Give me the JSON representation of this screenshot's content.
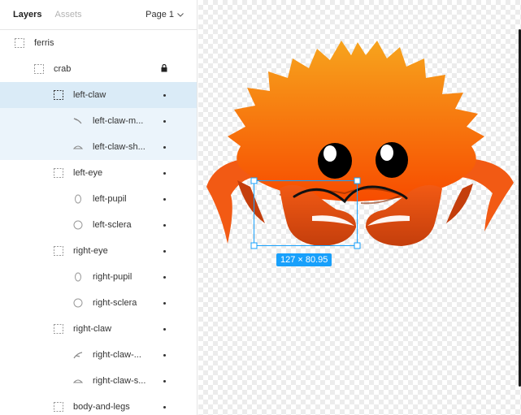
{
  "tabs": {
    "layers": "Layers",
    "assets": "Assets"
  },
  "page_select": {
    "label": "Page 1"
  },
  "layers": [
    {
      "label": "ferris",
      "icon": "frame-icon",
      "state": "normal"
    },
    {
      "label": "crab",
      "icon": "frame-icon",
      "state": "locked"
    },
    {
      "label": "left-claw",
      "icon": "frame-icon",
      "state": "selected"
    },
    {
      "label": "left-claw-m...",
      "icon": "vector-icon",
      "state": "child-selected"
    },
    {
      "label": "left-claw-sh...",
      "icon": "vector-icon",
      "state": "child-selected"
    },
    {
      "label": "left-eye",
      "icon": "frame-icon",
      "state": "normal"
    },
    {
      "label": "left-pupil",
      "icon": "ellipse-icon",
      "state": "normal"
    },
    {
      "label": "left-sclera",
      "icon": "ellipse-icon",
      "state": "normal"
    },
    {
      "label": "right-eye",
      "icon": "frame-icon",
      "state": "normal"
    },
    {
      "label": "right-pupil",
      "icon": "ellipse-icon",
      "state": "normal"
    },
    {
      "label": "right-sclera",
      "icon": "ellipse-icon",
      "state": "normal"
    },
    {
      "label": "right-claw",
      "icon": "frame-icon",
      "state": "normal"
    },
    {
      "label": "right-claw-...",
      "icon": "vector-icon",
      "state": "normal"
    },
    {
      "label": "right-claw-s...",
      "icon": "vector-icon",
      "state": "normal"
    },
    {
      "label": "body-and-legs",
      "icon": "frame-icon",
      "state": "normal"
    }
  ],
  "canvas": {
    "selection_dimensions": "127 × 80.95",
    "colors": {
      "selection": "#18a0fb",
      "crab_top": "#f7a41d",
      "crab_bottom": "#f74c00",
      "claw": "#c43e0c"
    }
  }
}
